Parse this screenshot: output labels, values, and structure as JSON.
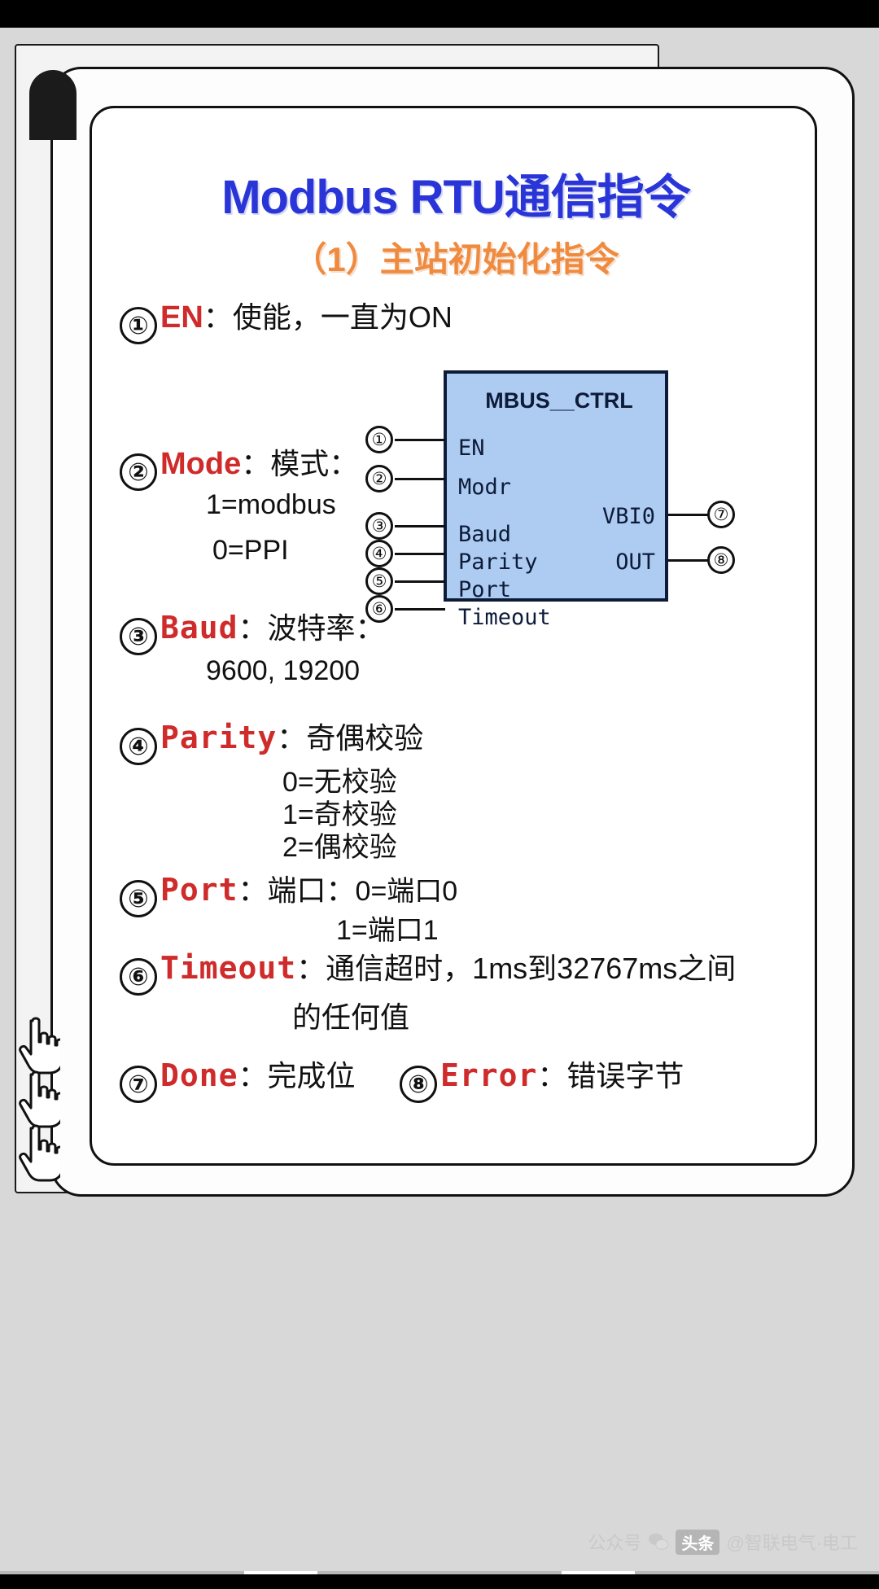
{
  "document": {
    "title": "Modbus RTU通信指令",
    "subtitle": "（1）主站初始化指令"
  },
  "items": [
    {
      "num": "①",
      "kw": "EN",
      "colon": "：",
      "cn": "使能，一直为ON",
      "subs": []
    },
    {
      "num": "②",
      "kw": "Mode",
      "colon": "：",
      "cn": "模式：",
      "subs": [
        "1=modbus",
        "0=PPI"
      ]
    },
    {
      "num": "③",
      "kw": "Baud",
      "colon": "：",
      "cn": "波特率：",
      "subs": [
        "9600, 19200"
      ]
    },
    {
      "num": "④",
      "kw": "Parity",
      "colon": "：",
      "cn": "奇偶校验",
      "subs": [
        "0=无校验",
        "1=奇校验",
        "2=偶校验"
      ]
    },
    {
      "num": "⑤",
      "kw": "Port",
      "colon": "：",
      "cn": "端口：",
      "cn2": "0=端口0",
      "subs": [
        "1=端口1"
      ]
    },
    {
      "num": "⑥",
      "kw": "Timeout",
      "colon": "：",
      "cn": "通信超时，1ms到32767ms之间",
      "subs": [
        "的任何值"
      ]
    },
    {
      "num": "⑦",
      "kw": "Done",
      "colon": "：",
      "cn": "完成位",
      "subs": []
    },
    {
      "num": "⑧",
      "kw": "Error",
      "colon": "：",
      "cn": "错误字节",
      "subs": []
    }
  ],
  "function_block": {
    "name": "MBUS__CTRL",
    "inputs": [
      {
        "pin": "①",
        "label": "EN"
      },
      {
        "pin": "②",
        "label": "Modr"
      },
      {
        "pin": "③",
        "label": "Baud"
      },
      {
        "pin": "④",
        "label": "Parity"
      },
      {
        "pin": "⑤",
        "label": "Port"
      },
      {
        "pin": "⑥",
        "label": "Timeout"
      }
    ],
    "outputs": [
      {
        "pin": "⑦",
        "label": "VBI0"
      },
      {
        "pin": "⑧",
        "label": "OUT"
      }
    ],
    "fill_color": "#aecbf2",
    "border_color": "#0c1b38"
  },
  "watermark": {
    "prefix": "公众号",
    "badge": "头条",
    "handle": "@智联电气·电工"
  },
  "colors": {
    "title_blue": "#2a35d8",
    "subtitle_orange": "#ef8b40",
    "keyword_red": "#cf2b2b",
    "page_grey": "#d8d8d8"
  }
}
